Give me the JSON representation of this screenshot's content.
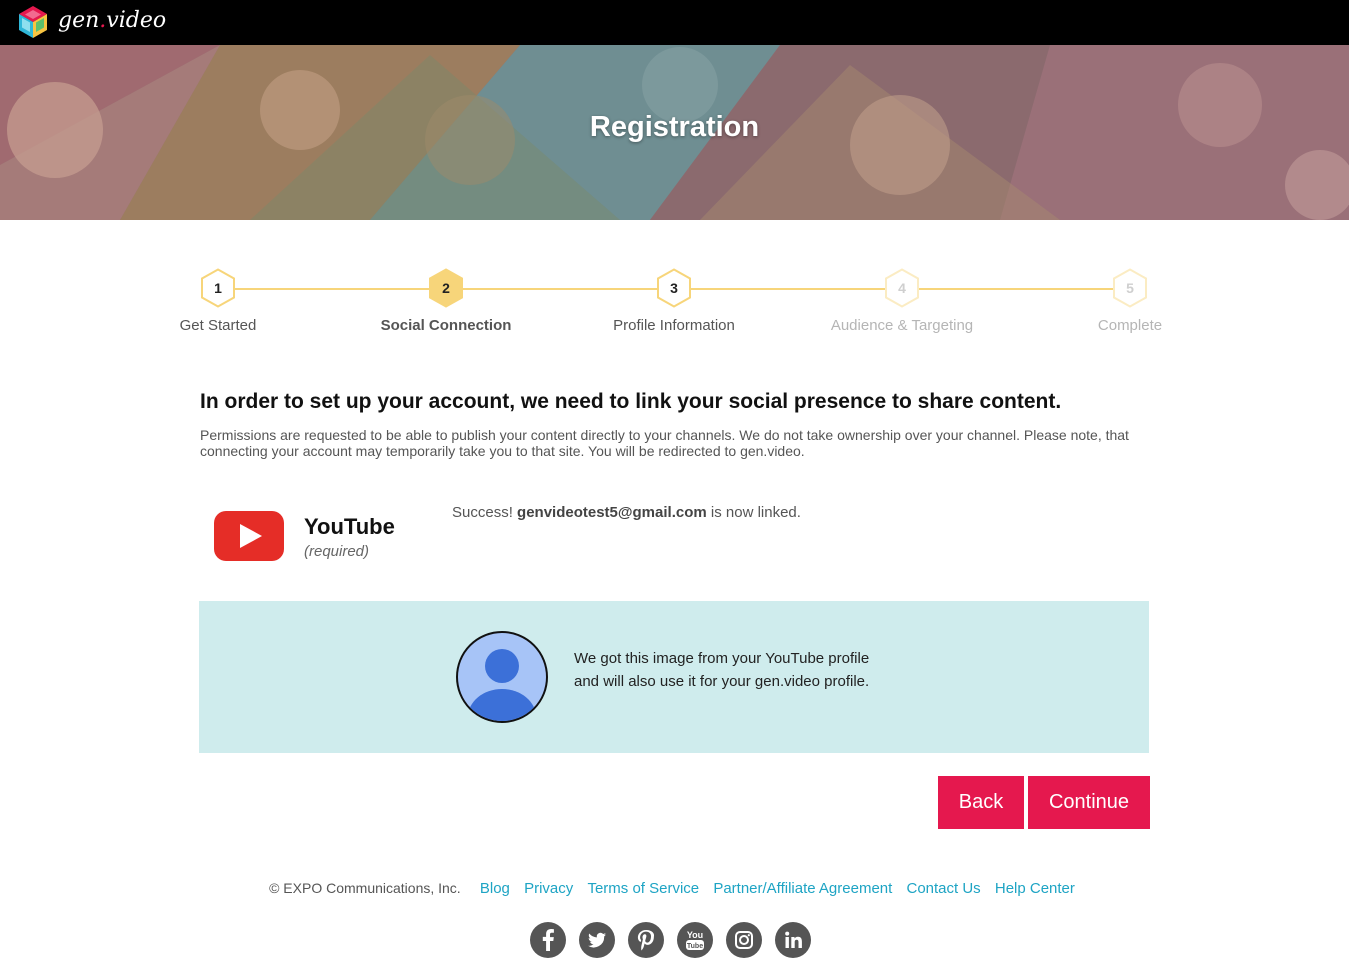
{
  "brand": {
    "name_prefix": "gen",
    "name_dot": ".",
    "name_suffix": "video"
  },
  "hero": {
    "title": "Registration"
  },
  "steps": [
    {
      "number": "1",
      "label": "Get Started",
      "state": "done"
    },
    {
      "number": "2",
      "label": "Social Connection",
      "state": "active"
    },
    {
      "number": "3",
      "label": "Profile Information",
      "state": "next"
    },
    {
      "number": "4",
      "label": "Audience & Targeting",
      "state": "disabled"
    },
    {
      "number": "5",
      "label": "Complete",
      "state": "disabled"
    }
  ],
  "content": {
    "heading": "In order to set up your account, we need to link your social presence to share content.",
    "description": "Permissions are requested to be able to publish your content directly to your channels. We do not take ownership over your channel. Please note, that connecting your account may temporarily take you to that site. You will be redirected to gen.video."
  },
  "youtube": {
    "name": "YouTube",
    "required": "(required)",
    "success_prefix": "Success! ",
    "success_email": "genvideotest5@gmail.com",
    "success_suffix": " is now linked."
  },
  "profile": {
    "line1": "We got this image from your YouTube profile",
    "line2": "and will also use it for your gen.video profile."
  },
  "buttons": {
    "back": "Back",
    "continue": "Continue"
  },
  "footer": {
    "copyright": "© EXPO Communications, Inc.",
    "links": [
      "Blog",
      "Privacy",
      "Terms of Service",
      "Partner/Affiliate Agreement",
      "Contact Us",
      "Help Center"
    ],
    "social": [
      "facebook-icon",
      "twitter-icon",
      "pinterest-icon",
      "youtube-icon",
      "instagram-icon",
      "linkedin-icon"
    ]
  },
  "colors": {
    "accent": "#e5184e",
    "link": "#1ea4c4",
    "step": "#f7d57a",
    "profile_bg": "#cfeced",
    "youtube_red": "#e52d27"
  }
}
